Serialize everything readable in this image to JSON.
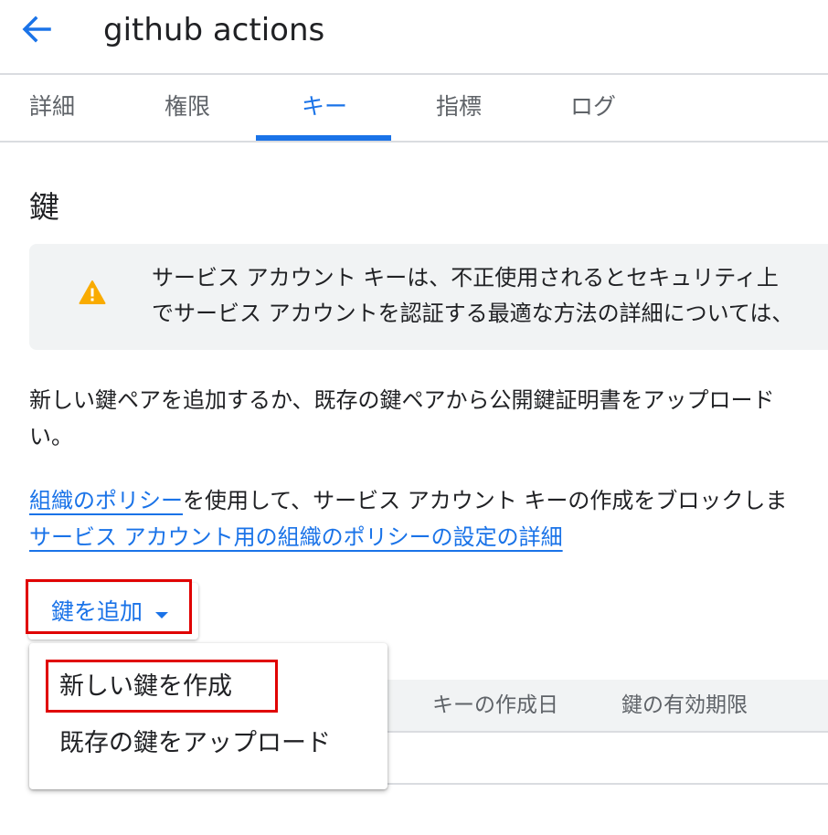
{
  "header": {
    "title": "github actions",
    "back_icon": "arrow-left-icon"
  },
  "tabs": [
    {
      "label": "詳細"
    },
    {
      "label": "権限"
    },
    {
      "label": "キー",
      "active": true
    },
    {
      "label": "指標"
    },
    {
      "label": "ログ"
    }
  ],
  "section_title": "鍵",
  "warning": {
    "icon": "warning-icon",
    "line1": "サービス アカウント キーは、不正使用されるとセキュリティ上",
    "line2": "でサービス アカウントを認証する最適な方法の詳細については、"
  },
  "description": {
    "line1": "新しい鍵ペアを追加するか、既存の鍵ペアから公開鍵証明書をアップロード",
    "line2": "い。"
  },
  "policy": {
    "link1": "組織のポリシー",
    "text1": "を使用して、サービス アカウント キーの作成をブロックしま",
    "link2": "サービス アカウント用の組織のポリシーの設定の詳細"
  },
  "add_key_button": {
    "label": "鍵を追加",
    "icon": "caret-down-icon"
  },
  "menu": {
    "items": [
      {
        "label": "新しい鍵を作成"
      },
      {
        "label": "既存の鍵をアップロード"
      }
    ]
  },
  "table": {
    "columns": [
      "キーの作成日",
      "鍵の有効期限"
    ]
  },
  "colors": {
    "accent": "#1a73e8",
    "warning": "#f9ab00",
    "highlight": "#e00000"
  }
}
